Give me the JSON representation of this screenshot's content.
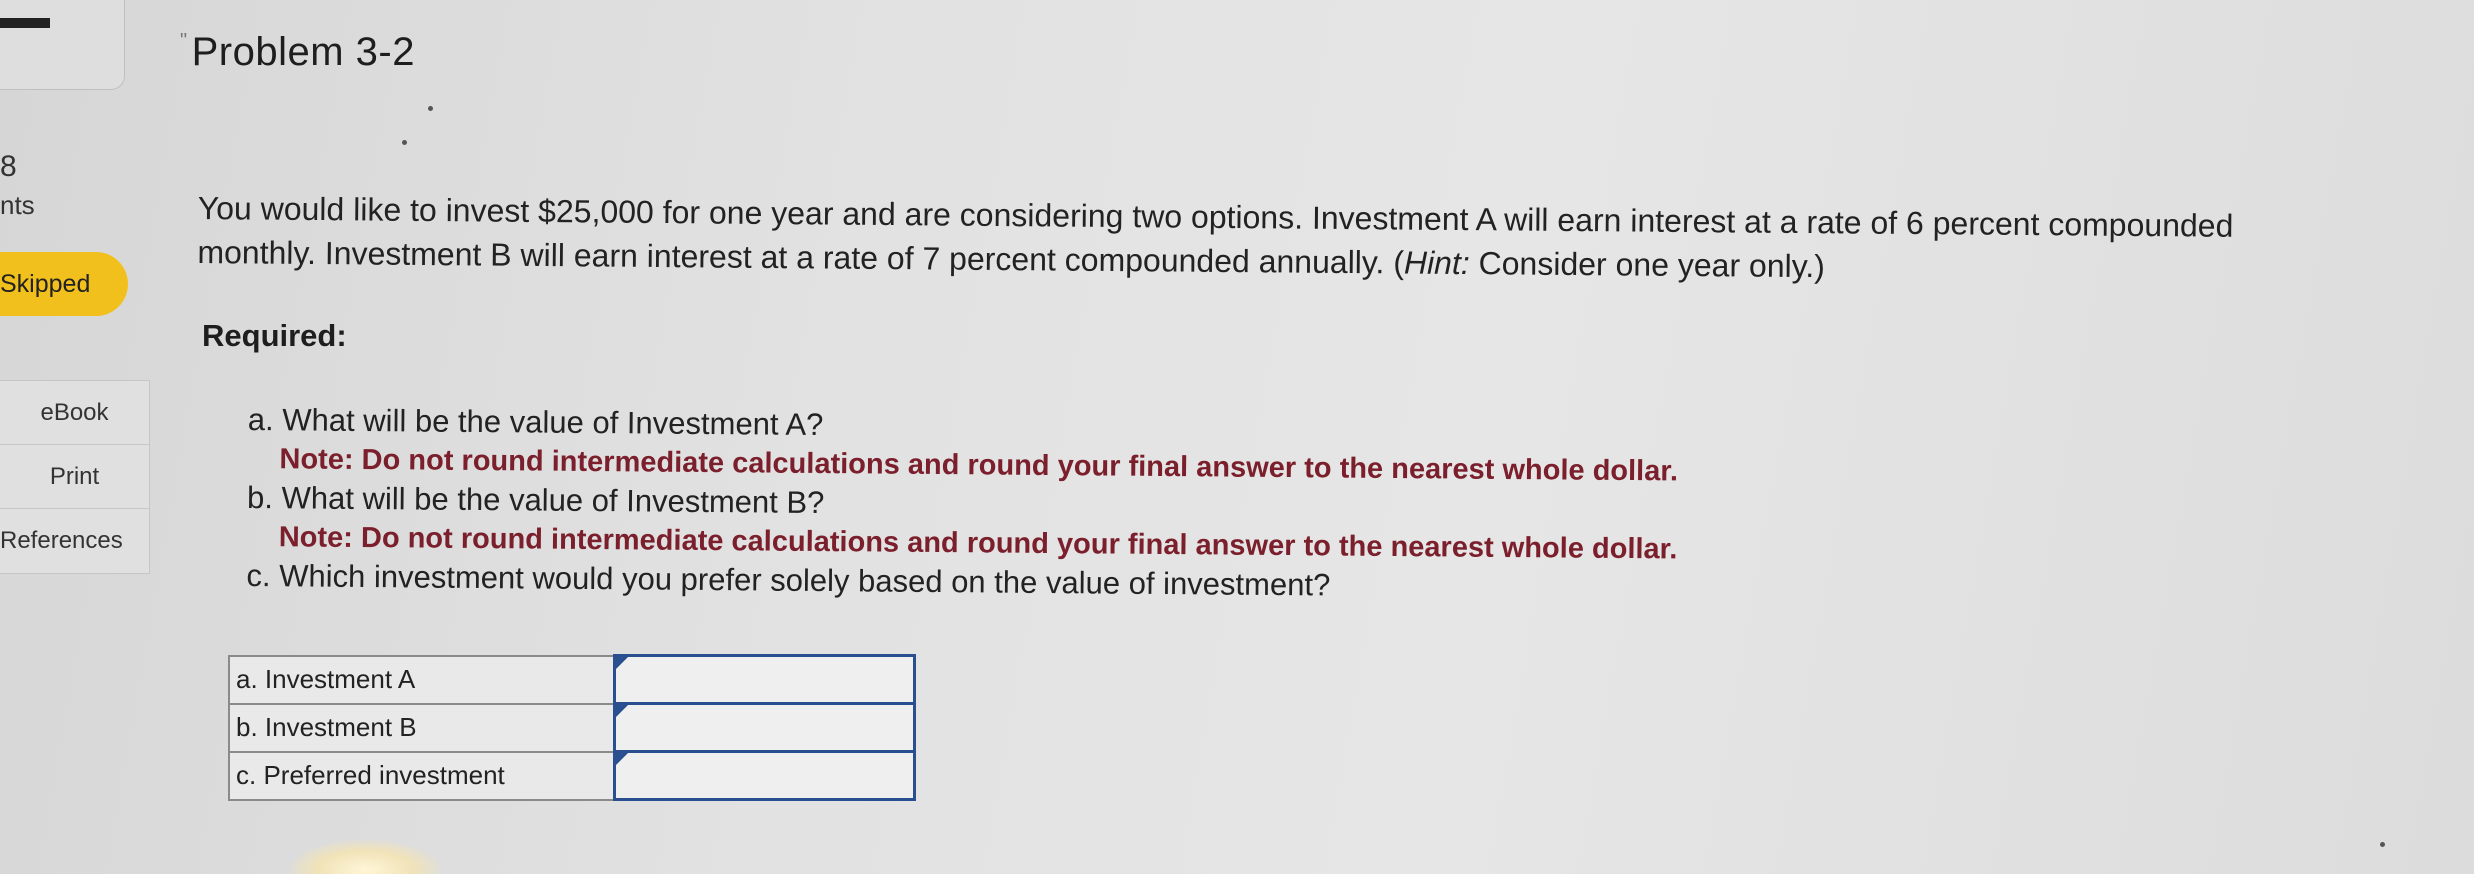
{
  "sidebar": {
    "question_number": "8",
    "points_label": "nts",
    "skipped_label": "Skipped",
    "links": [
      {
        "label": "eBook"
      },
      {
        "label": "Print"
      },
      {
        "label": "References"
      }
    ]
  },
  "problem": {
    "title": "Problem 3-2",
    "intro_main": "You would like to invest $25,000 for one year and are considering two options. Investment A will earn interest at a rate of 6 percent compounded monthly. Investment B will earn interest at a rate of 7 percent compounded annually. (",
    "hint_label": "Hint:",
    "hint_text": " Consider one year only.)",
    "required_label": "Required:",
    "questions": [
      {
        "text": "a. What will be the value of Investment A?",
        "note": "Note: Do not round intermediate calculations and round your final answer to the nearest whole dollar."
      },
      {
        "text": "b. What will be the value of Investment B?",
        "note": "Note: Do not round intermediate calculations and round your final answer to the nearest whole dollar."
      },
      {
        "text": "c. Which investment would you prefer solely based on the value of investment?",
        "note": ""
      }
    ]
  },
  "answer_table": {
    "rows": [
      {
        "label": "a. Investment A",
        "value": ""
      },
      {
        "label": "b. Investment B",
        "value": ""
      },
      {
        "label": "c. Preferred investment",
        "value": ""
      }
    ]
  },
  "colors": {
    "skipped_badge": "#f2c01c",
    "note_text": "#7a1f2b",
    "input_border": "#2a4f91"
  }
}
